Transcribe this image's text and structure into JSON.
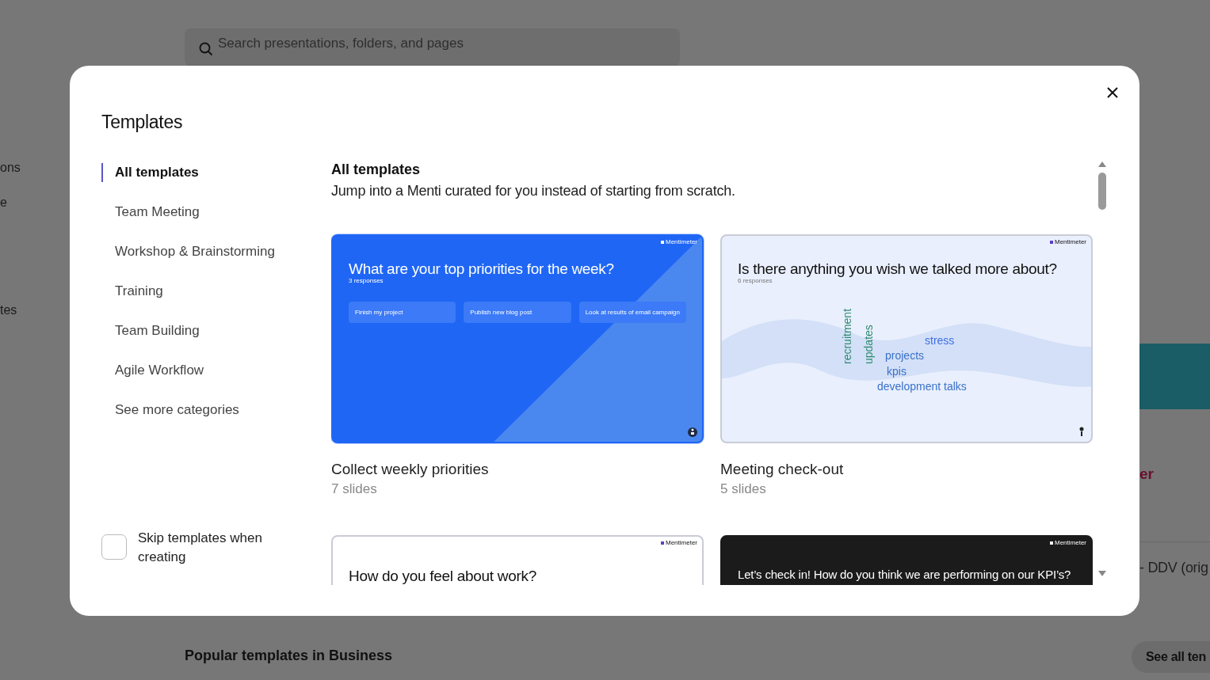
{
  "background": {
    "search": {
      "placeholder": "Search presentations, folders, and pages"
    },
    "side_texts": [
      "ons",
      "e",
      "tes"
    ],
    "card_title": "er",
    "list_text": "- DDV (orig",
    "section_title": "Popular templates in Business",
    "see_all_button": "See all ten"
  },
  "dialog": {
    "title": "Templates",
    "categories": [
      {
        "label": "All templates",
        "selected": true
      },
      {
        "label": "Team Meeting",
        "selected": false
      },
      {
        "label": "Workshop & Brainstorming",
        "selected": false
      },
      {
        "label": "Training",
        "selected": false
      },
      {
        "label": "Team Building",
        "selected": false
      },
      {
        "label": "Agile Workflow",
        "selected": false
      },
      {
        "label": "See more categories",
        "selected": false
      }
    ],
    "skip_checkbox": {
      "label": "Skip templates when creating",
      "checked": false
    },
    "heading": "All templates",
    "subheading": "Jump into a Menti curated for you instead of starting from scratch.",
    "templates": [
      {
        "name": "Collect weekly priorities",
        "slides": "7 slides",
        "selected": true,
        "slide": {
          "kind": "list",
          "brand": "Mentimeter",
          "question": "What are your top priorities for the week?",
          "responses_count": "3 responses",
          "responses": [
            "Finish my project",
            "Publish new blog post",
            "Look at results of email campaign"
          ]
        }
      },
      {
        "name": "Meeting check-out",
        "slides": "5 slides",
        "selected": false,
        "slide": {
          "kind": "wordcloud",
          "brand": "Mentimeter",
          "question": "Is there anything you wish we talked more about?",
          "responses_count": "6 responses",
          "words": [
            {
              "text": "recruitment",
              "kind": "vertical",
              "color": "#2f8a70"
            },
            {
              "text": "updates",
              "kind": "vertical",
              "color": "#2f8a70"
            },
            {
              "text": "stress",
              "kind": "horizontal",
              "color": "#3f6fe6"
            },
            {
              "text": "projects",
              "kind": "horizontal",
              "color": "#3a72c8"
            },
            {
              "text": "kpis",
              "kind": "horizontal",
              "color": "#3a72c8"
            },
            {
              "text": "development talks",
              "kind": "horizontal",
              "color": "#3a72c8"
            }
          ]
        }
      },
      {
        "selected": false,
        "slide": {
          "kind": "plain",
          "brand": "Mentimeter",
          "question": "How do you feel about work?"
        }
      },
      {
        "selected": false,
        "slide": {
          "kind": "dark",
          "brand": "Mentimeter",
          "question": "Let’s check in! How do you think we are performing on our KPI’s?"
        }
      }
    ]
  }
}
